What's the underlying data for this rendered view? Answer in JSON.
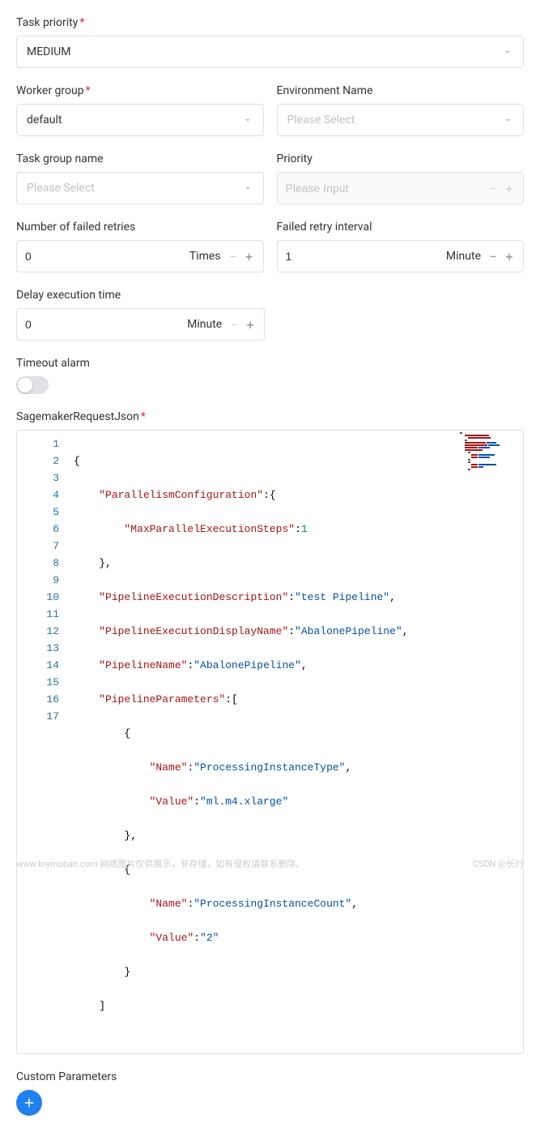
{
  "labels": {
    "task_priority": "Task priority",
    "worker_group": "Worker group",
    "environment_name": "Environment Name",
    "task_group_name": "Task group name",
    "priority": "Priority",
    "failed_retries": "Number of failed retries",
    "retry_interval": "Failed retry interval",
    "delay_execution": "Delay execution time",
    "timeout_alarm": "Timeout alarm",
    "sagemaker_json": "SagemakerRequestJson",
    "custom_parameters": "Custom Parameters"
  },
  "values": {
    "task_priority": "MEDIUM",
    "worker_group": "default",
    "failed_retries": "0",
    "retry_interval": "1",
    "delay_execution": "0"
  },
  "placeholders": {
    "select": "Please Select",
    "input": "Please Input"
  },
  "units": {
    "times": "Times",
    "minute": "Minute"
  },
  "code": {
    "lines": [
      "1",
      "2",
      "3",
      "4",
      "5",
      "6",
      "7",
      "8",
      "9",
      "10",
      "11",
      "12",
      "13",
      "14",
      "15",
      "16",
      "17"
    ],
    "tokens": {
      "parallelism_config": "\"ParallelismConfiguration\"",
      "max_parallel": "\"MaxParallelExecutionSteps\"",
      "max_parallel_val": "1",
      "exec_desc": "\"PipelineExecutionDescription\"",
      "exec_desc_val": "\"test Pipeline\"",
      "display_name": "\"PipelineExecutionDisplayName\"",
      "display_name_val": "\"AbalonePipeline\"",
      "pipeline_name": "\"PipelineName\"",
      "pipeline_name_val": "\"AbalonePipeline\"",
      "pipeline_params": "\"PipelineParameters\"",
      "name1": "\"Name\"",
      "name1_val": "\"ProcessingInstanceType\"",
      "value1": "\"Value\"",
      "value1_val": "\"ml.m4.xlarge\"",
      "name2": "\"Name\"",
      "name2_val": "\"ProcessingInstanceCount\"",
      "value2": "\"Value\"",
      "value2_val": "\"2\""
    }
  },
  "footer": {
    "left": "www.toymoban.com 网络图片仅供展示，非存储，如有侵权请联系删除。",
    "right": "CSDN @长行"
  }
}
